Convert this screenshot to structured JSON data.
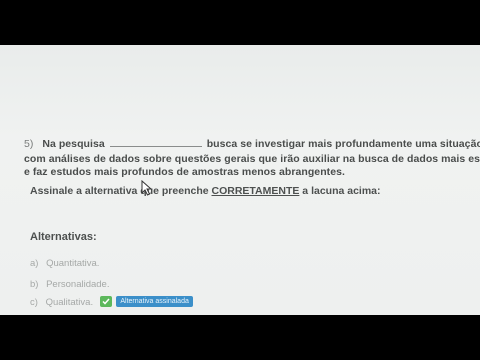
{
  "question": {
    "number": "5)",
    "line1_start": "Na pesquisa",
    "line1_end": "busca se investigar mais profundamente uma situação,",
    "line2": "com análises de dados sobre questões gerais que irão auxiliar na busca de dados mais espe",
    "line3": "e faz estudos mais profundos de amostras menos abrangentes.",
    "instruction_before": "Assinale a alternativa que preenche ",
    "instruction_emphasis": "CORRETAMENTE",
    "instruction_after": " a lacuna acima:"
  },
  "alternatives": {
    "title": "Alternativas:",
    "items": [
      {
        "letter": "a)",
        "text": "Quantitativa."
      },
      {
        "letter": "b)",
        "text": "Personalidade."
      },
      {
        "letter": "c)",
        "text": "Qualitativa.",
        "badge": "Alternativa assinalada"
      }
    ]
  },
  "colors": {
    "badge": "#3b8fc9",
    "check": "#5cb85c"
  },
  "icons": [
    "check-icon",
    "mouse-cursor-icon"
  ]
}
